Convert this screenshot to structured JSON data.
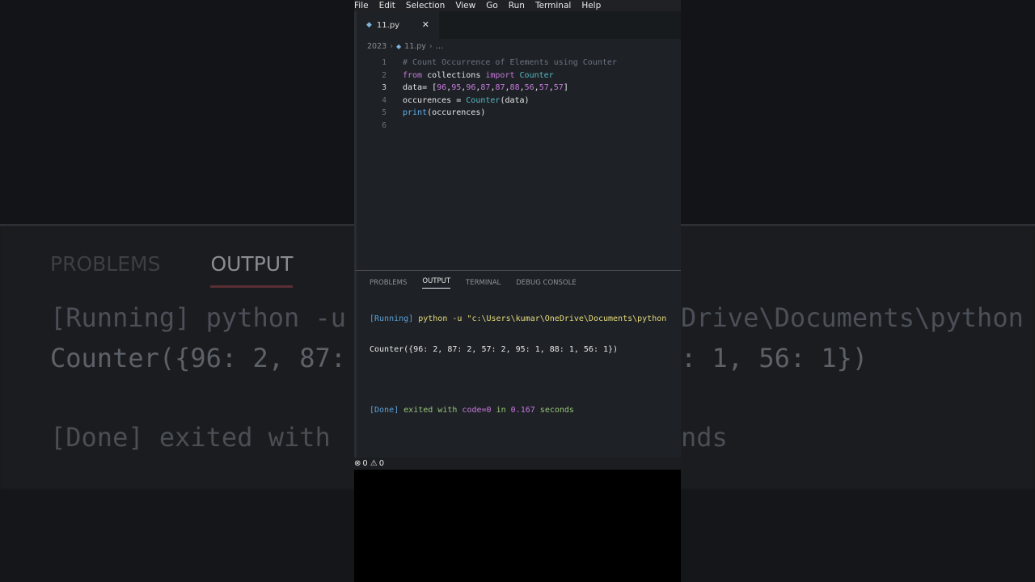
{
  "menu": [
    "File",
    "Edit",
    "Selection",
    "View",
    "Go",
    "Run",
    "Terminal",
    "Help"
  ],
  "tab": {
    "label": "11.py",
    "close": "✕"
  },
  "breadcrumb": {
    "folder": "2023",
    "file": "11.py",
    "more": "…"
  },
  "code_lines": [
    {
      "n": "1",
      "text": "# Count Occurrence of Elements using Counter"
    },
    {
      "n": "2",
      "text": "from collections import Counter"
    },
    {
      "n": "3",
      "text": "data= [96,95,96,87,87,88,56,57,57]"
    },
    {
      "n": "4",
      "text": "occurences = Counter(data)"
    },
    {
      "n": "5",
      "text": "print(occurences)"
    },
    {
      "n": "6",
      "text": ""
    }
  ],
  "panel": {
    "tabs": [
      "PROBLEMS",
      "OUTPUT",
      "TERMINAL",
      "DEBUG CONSOLE"
    ],
    "active_tab": "OUTPUT",
    "running_tag": "[Running]",
    "running_cmd": "python -u \"c:\\Users\\kumar\\OneDrive\\Documents\\python",
    "result": "Counter({96: 2, 87: 2, 57: 2, 95: 1, 88: 1, 56: 1})",
    "done_tag": "[Done]",
    "done_1": "exited with",
    "done_code": "code=0",
    "done_2": "in",
    "done_time": "0.167",
    "done_3": "seconds"
  },
  "status": {
    "errors": "0",
    "warnings": "0"
  },
  "background": {
    "tabs": [
      "PROBLEMS",
      "OUTPUT"
    ],
    "left_1": "[Running] python -u",
    "right_1": "Drive\\Documents\\python",
    "left_2": "Counter({96: 2, 87:",
    "right_2": ": 1, 56: 1})",
    "left_3": "[Done] exited with",
    "right_3": "nds"
  }
}
